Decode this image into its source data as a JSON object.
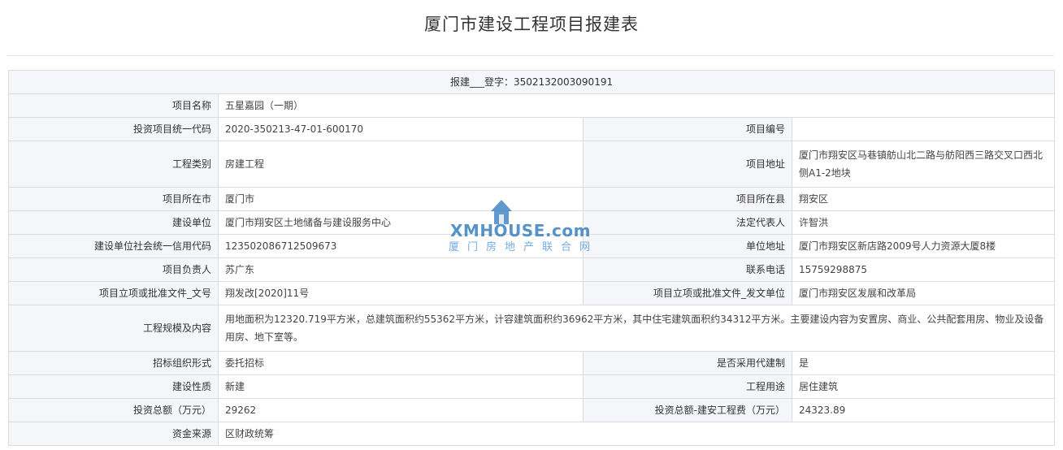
{
  "page": {
    "title": "厦门市建设工程项目报建表"
  },
  "table": {
    "header": "报建___登字：3502132003090191",
    "project_name_label": "项目名称",
    "project_name": "五星嘉园（一期）",
    "invest_code_label": "投资项目统一代码",
    "invest_code": "2020-350213-47-01-600170",
    "project_no_label": "项目编号",
    "project_no": "",
    "category_label": "工程类别",
    "category": "房建工程",
    "address_label": "项目地址",
    "address": "厦门市翔安区马巷镇舫山北二路与舫阳西三路交叉口西北侧A1-2地块",
    "city_label": "项目所在市",
    "city": "厦门市",
    "county_label": "项目所在县",
    "county": "翔安区",
    "builder_label": "建设单位",
    "builder": "厦门市翔安区土地储备与建设服务中心",
    "legal_rep_label": "法定代表人",
    "legal_rep": "许智洪",
    "credit_code_label": "建设单位社会统一信用代码",
    "credit_code": "123502086712509673",
    "unit_address_label": "单位地址",
    "unit_address": "厦门市翔安区新店路2009号人力资源大厦8楼",
    "manager_label": "项目负责人",
    "manager": "苏广东",
    "phone_label": "联系电话",
    "phone": "15759298875",
    "approval_no_label": "项目立项或批准文件_文号",
    "approval_no": "翔发改[2020]11号",
    "approval_unit_label": "项目立项或批准文件_发文单位",
    "approval_unit": "厦门市翔安区发展和改革局",
    "scale_label": "工程规模及内容",
    "scale": "用地面积为12320.719平方米，总建筑面积约55362平方米，计容建筑面积约36962平方米，其中住宅建筑面积约34312平方米。主要建设内容为安置房、商业、公共配套用房、物业及设备用房、地下室等。",
    "tender_label": "招标组织形式",
    "tender": "委托招标",
    "agent_label": "是否采用代建制",
    "agent": "是",
    "nature_label": "建设性质",
    "nature": "新建",
    "usage_label": "工程用途",
    "usage": "居住建筑",
    "investment_label": "投资总额（万元）",
    "investment": "29262",
    "install_cost_label": "投资总额-建安工程费（万元）",
    "install_cost": "24323.89",
    "funding_label": "资金来源",
    "funding": "区财政统筹"
  },
  "watermark": {
    "top": "XMHOUSE.com",
    "bottom": "厦门房地产联合网",
    "color": "#1e6fb8"
  }
}
